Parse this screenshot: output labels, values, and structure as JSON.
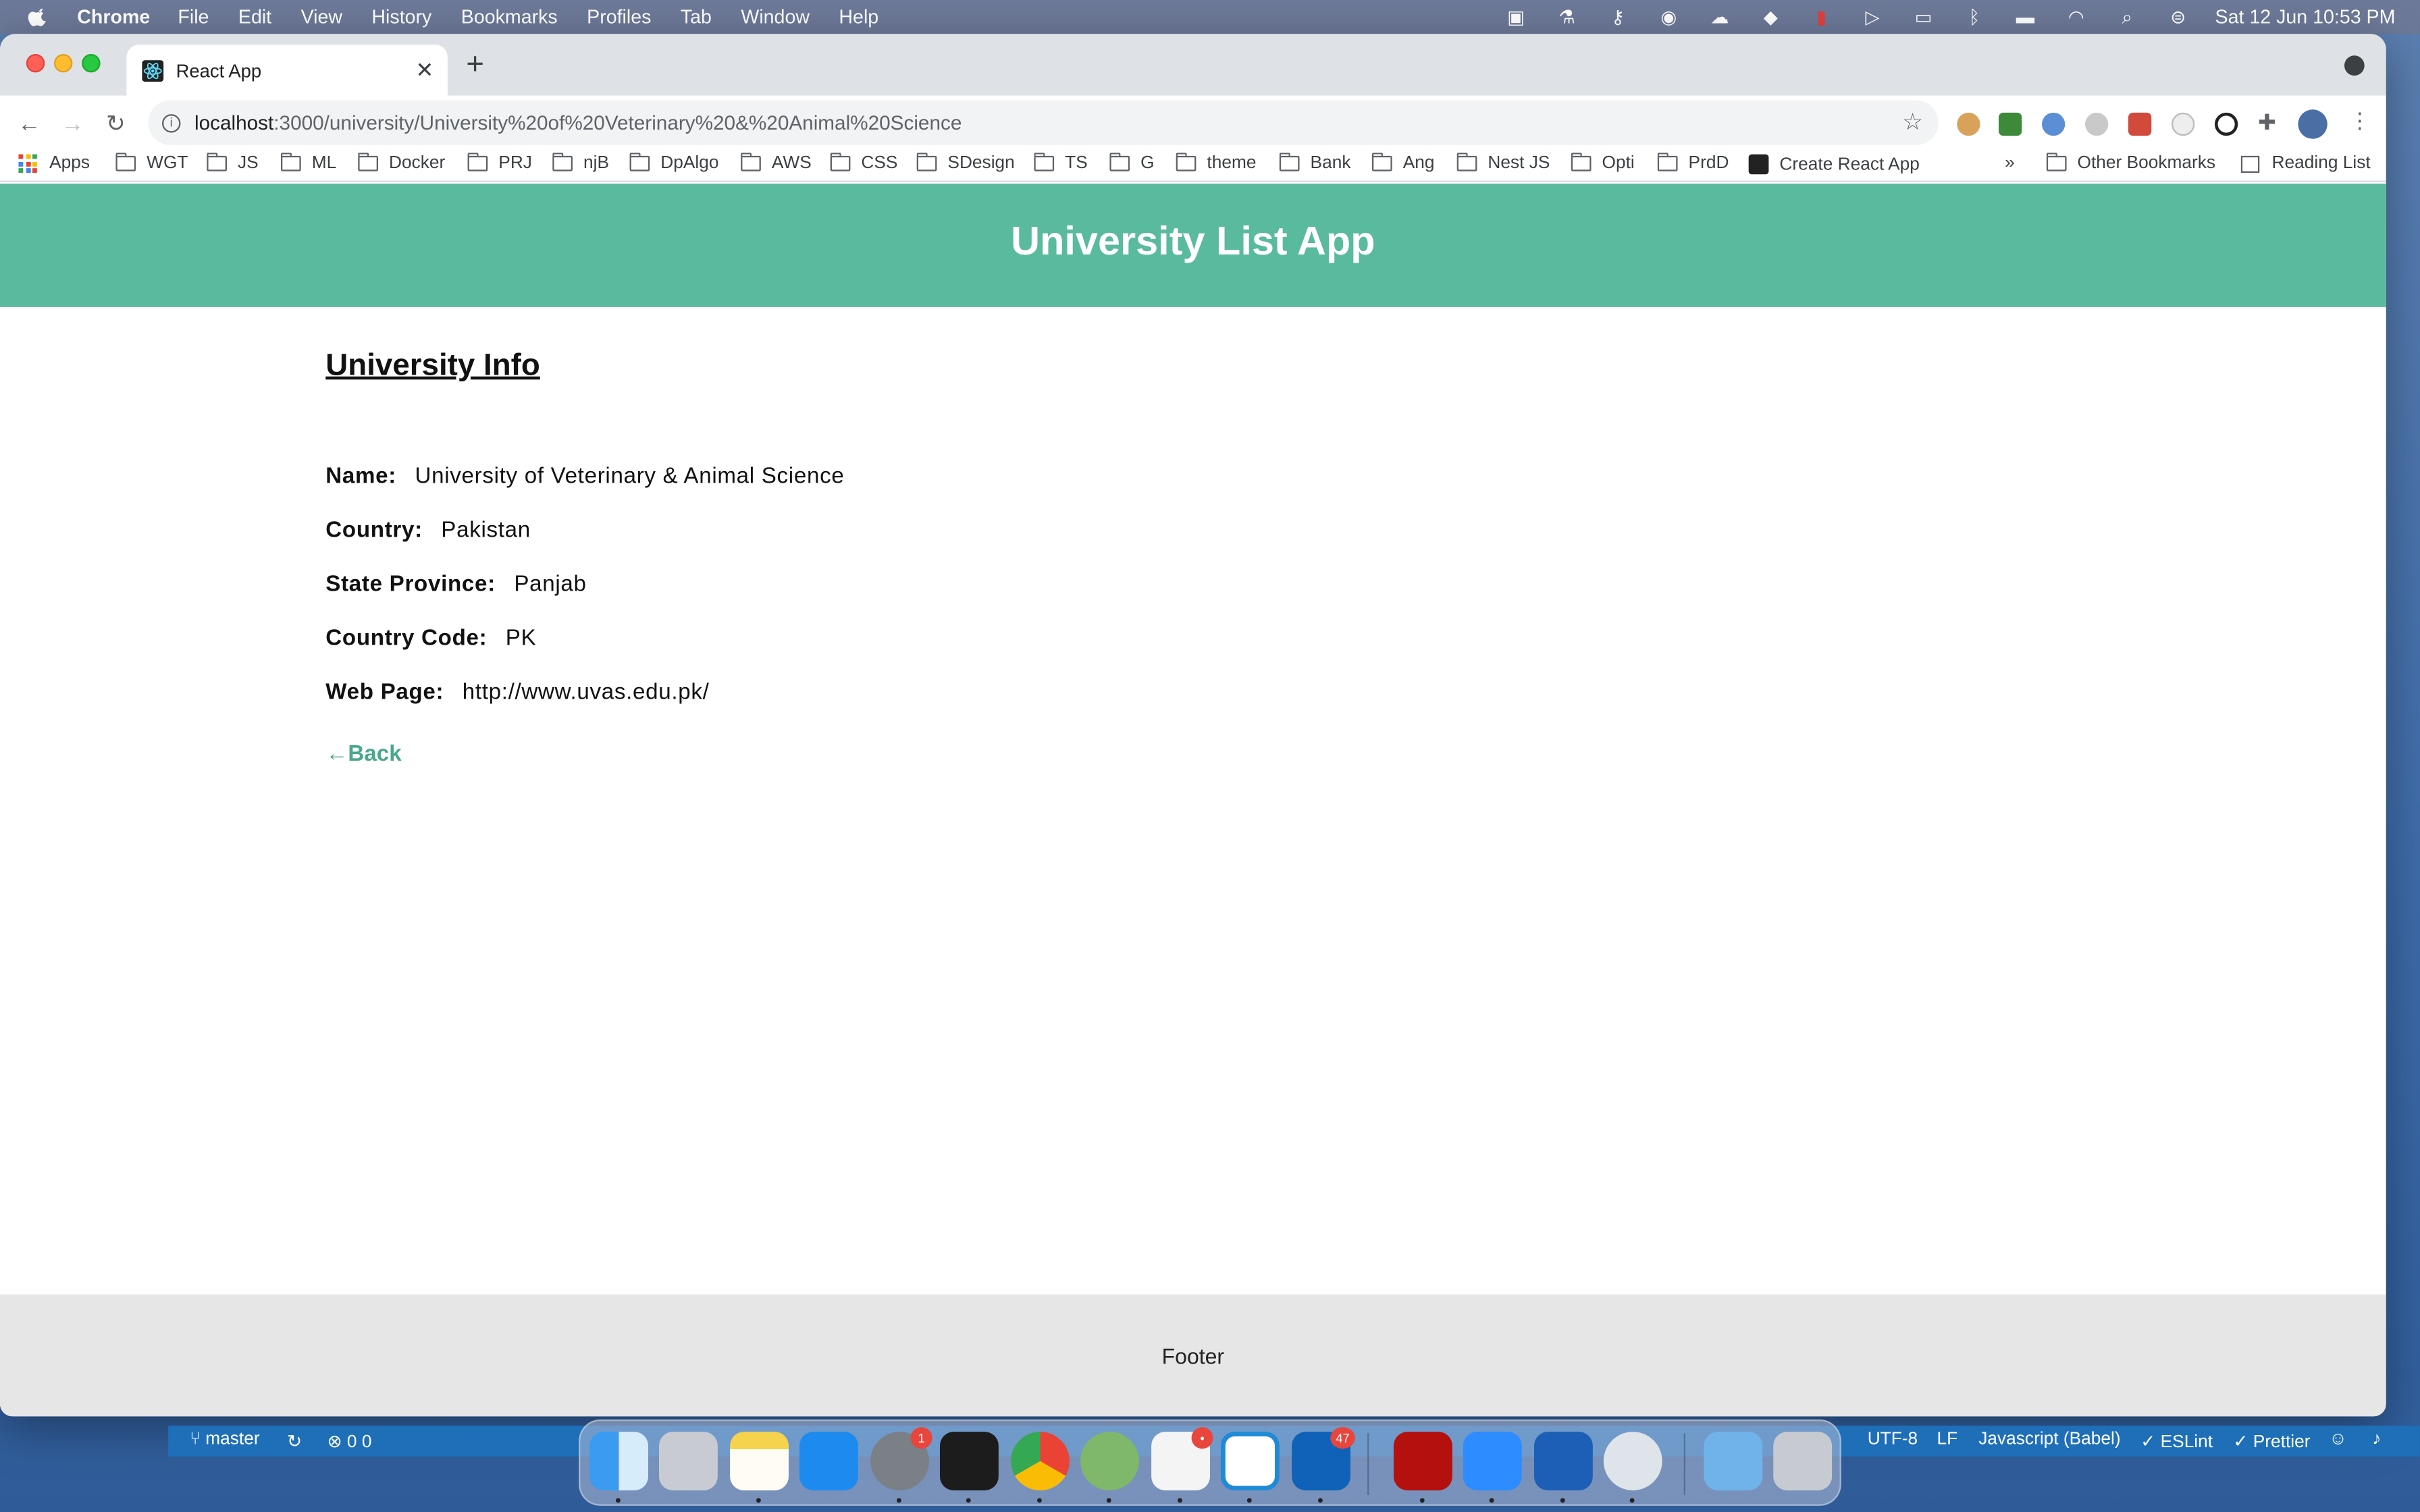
{
  "menubar": {
    "app_name": "Chrome",
    "items": [
      "File",
      "Edit",
      "View",
      "History",
      "Bookmarks",
      "Profiles",
      "Tab",
      "Window",
      "Help"
    ],
    "clock": "Sat 12 Jun  10:53 PM"
  },
  "browser": {
    "tab_title": "React App",
    "url_host": "localhost",
    "url_path": ":3000/university/University%20of%20Veterinary%20&%20Animal%20Science",
    "bookmarks": [
      "Apps",
      "WGT",
      "JS",
      "ML",
      "Docker",
      "PRJ",
      "njB",
      "DpAlgo",
      "AWS",
      "CSS",
      "SDesign",
      "TS",
      "G",
      "theme",
      "Bank",
      "Ang",
      "Nest JS",
      "Opti",
      "PrdD",
      "Create React App"
    ],
    "bookmarks_overflow": "»",
    "other_bookmarks": "Other Bookmarks",
    "reading_list": "Reading List"
  },
  "page": {
    "app_title": "University List App",
    "section_title": "University Info",
    "fields": [
      {
        "label": "Name:",
        "value": "University of Veterinary & Animal Science"
      },
      {
        "label": "Country:",
        "value": "Pakistan"
      },
      {
        "label": "State Province:",
        "value": "Panjab"
      },
      {
        "label": "Country Code:",
        "value": "PK"
      },
      {
        "label": "Web Page:",
        "value": "http://www.uvas.edu.pk/"
      }
    ],
    "back_label": "←Back",
    "footer": "Footer",
    "colors": {
      "header": "#5aba9e",
      "link": "#4aa88a",
      "footer_bg": "#e6e6e6"
    }
  },
  "vscode_status": {
    "branch": "master",
    "problems": "0  0",
    "encoding": "UTF-8",
    "eol": "LF",
    "language": "Javascript (Babel)",
    "eslint": "ESLint",
    "prettier": "Prettier"
  },
  "dock": {
    "badges": {
      "settings": "1",
      "slack": "•",
      "outlook": "47"
    }
  }
}
